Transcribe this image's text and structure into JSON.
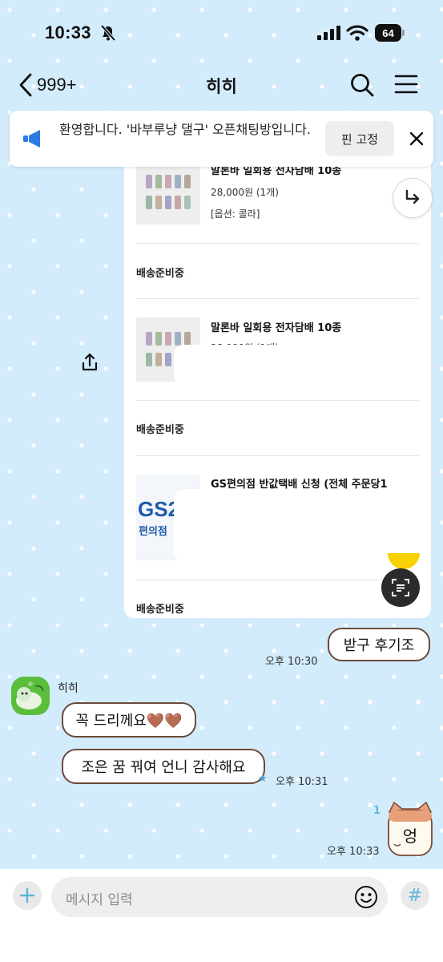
{
  "status_bar": {
    "time": "10:33",
    "battery": "64"
  },
  "header": {
    "back_count": "999+",
    "title": "히히"
  },
  "notice": {
    "text": "환영합니다. '바부루냥 댈구' 오픈채팅방입니다.",
    "pin_label": "핀 고정"
  },
  "order_card": {
    "item1": {
      "name": "말론바 일회용 전자담배 10종",
      "price": "28,000원 (1개)",
      "option": "[옵션: 콜라]"
    },
    "status1": "배송준비중",
    "item2": {
      "name": "말론바 일회용 전자담배 10종",
      "price_partial": "28,000원 (1개)"
    },
    "status2": "배송준비중",
    "item3": {
      "name": "GS편의점 반값택배 신청 (전체 주문당1",
      "logo_text": "GS2",
      "logo_sub": "편의점"
    },
    "status3": "배송준비중"
  },
  "messages": [
    {
      "text": "받구 후기조",
      "time": "오후 10:30"
    },
    {
      "sender": "히히",
      "text": "꼭 드리께요🤎🤎"
    },
    {
      "text": "조은 꿈 꿔여 언니 감사해요",
      "time": "오후 10:31"
    },
    {
      "text": "엉",
      "time": "오후 10:33",
      "unread": "1"
    }
  ],
  "input": {
    "placeholder": "메시지 입력"
  },
  "colors": {
    "chat_bg": "#d3ecfb",
    "bubble_border": "#6b4a3a",
    "accent": "#5fb4d8"
  }
}
